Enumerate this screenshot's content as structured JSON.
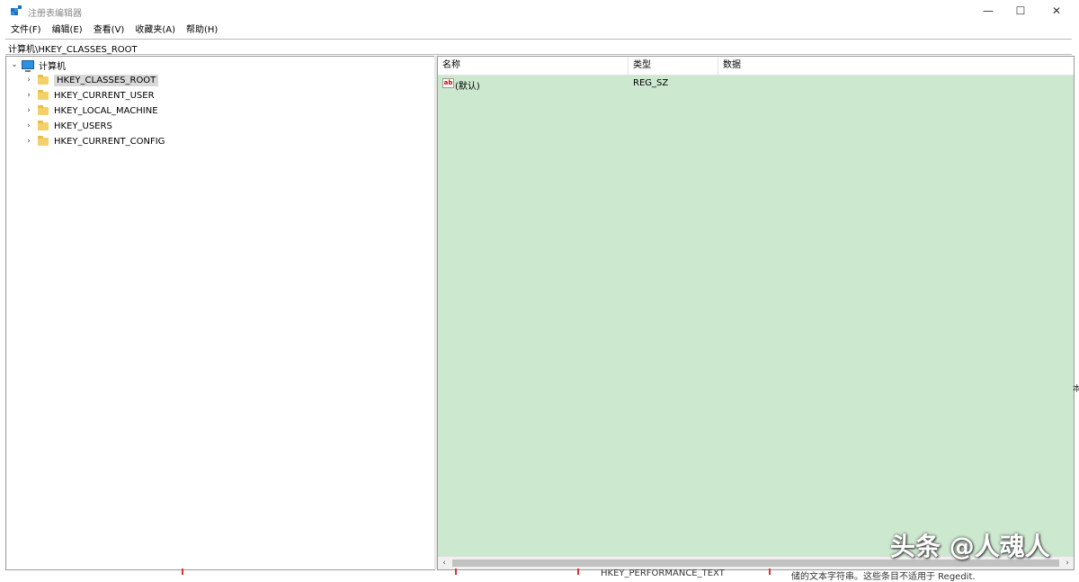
{
  "window": {
    "title": "注册表编辑器",
    "minimize": "—",
    "maximize": "☐",
    "close": "✕"
  },
  "menu": [
    "文件(F)",
    "编辑(E)",
    "查看(V)",
    "收藏夹(A)",
    "帮助(H)"
  ],
  "address": "计算机\\HKEY_CLASSES_ROOT",
  "tree": {
    "root": "计算机",
    "items": [
      "HKEY_CLASSES_ROOT",
      "HKEY_CURRENT_USER",
      "HKEY_LOCAL_MACHINE",
      "HKEY_USERS",
      "HKEY_CURRENT_CONFIG"
    ],
    "selected_index": 0
  },
  "list": {
    "columns": [
      "名称",
      "类型",
      "数据"
    ],
    "rows": [
      {
        "name": "(默认)",
        "type": "REG_SZ",
        "data": ""
      }
    ],
    "background": "#cce8cf"
  },
  "watermark": "头条 @人魂人",
  "bottom_fragments": [
    "HKEY_PERFORMANCE_TEXT",
    "储的文本字符串。这些条目不适用于 Regedit."
  ],
  "side_fragment": "本"
}
